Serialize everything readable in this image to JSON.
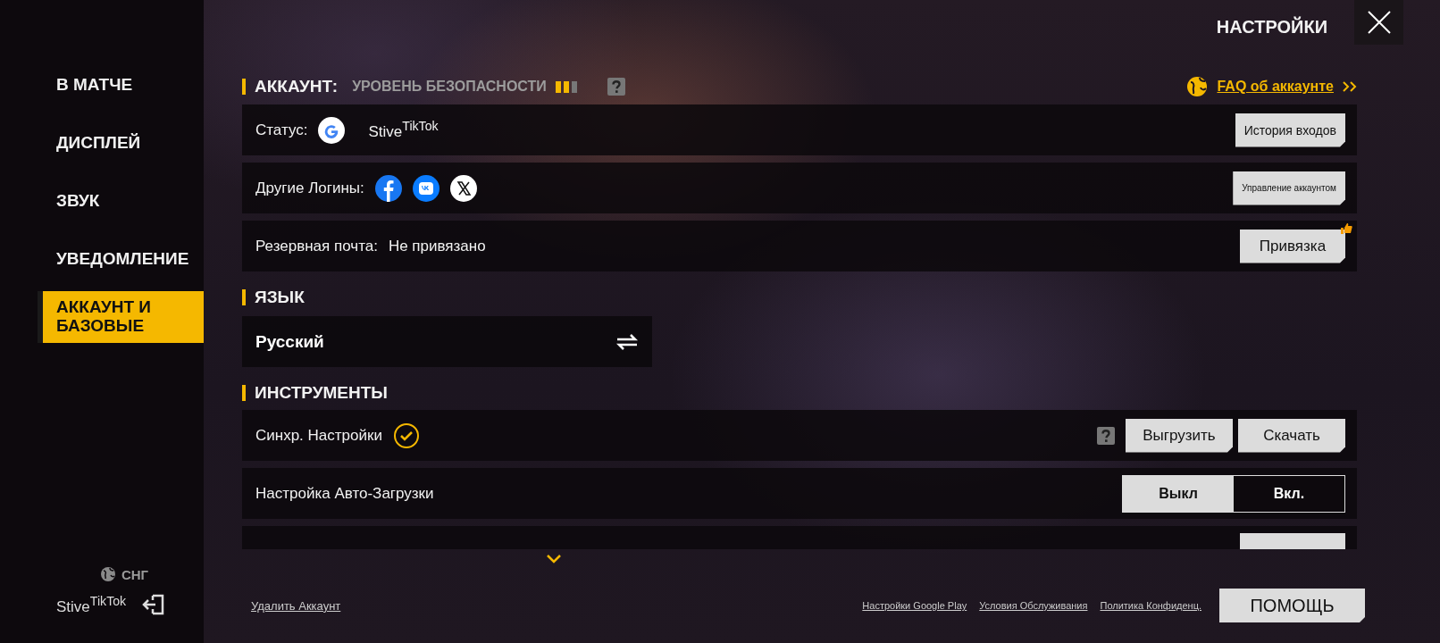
{
  "header": {
    "title": "НАСТРОЙКИ"
  },
  "sidebar": {
    "items": [
      {
        "label": "В МАТЧЕ",
        "selected": false
      },
      {
        "label": "ДИСПЛЕЙ",
        "selected": false
      },
      {
        "label": "ЗВУК",
        "selected": false
      },
      {
        "label": "УВЕДОМЛЕНИЕ",
        "selected": false
      },
      {
        "label": "АККАУНТ И БАЗОВЫЕ",
        "selected": true
      }
    ],
    "region": "СНГ",
    "username": "Stive$^{TikTok}$"
  },
  "account": {
    "title": "АККАУНТ:",
    "subtitle": "УРОВЕНЬ БЕЗОПАСНОСТИ",
    "level": 0.67,
    "link": "FAQ об аккаунте",
    "rows": [
      {
        "kind": "status",
        "label": "Статус:",
        "value": "Stive$^{TikTok}$",
        "buttons": [
          "История входов"
        ]
      },
      {
        "kind": "logins",
        "label": "Другие Логины:",
        "buttons": [
          "Управление аккаунтом"
        ]
      },
      {
        "kind": "text",
        "label": "Резервная почта:",
        "value": "Не привязано",
        "buttons": [
          "Привязка"
        ]
      }
    ]
  },
  "language": {
    "title": "ЯЗЫК",
    "value": "Русский"
  },
  "tools": {
    "title": "ИНСТРУМЕНТЫ",
    "rows": [
      {
        "kind": "sync",
        "label": "Синхр. Настройки",
        "checked": true,
        "buttons": [
          "Выгрузить",
          "Скачать"
        ]
      },
      {
        "kind": "toggle",
        "label": "Настройка Авто-Загрузки",
        "options": [
          {
            "label": "Выкл",
            "selected": false
          },
          {
            "label": "Вкл.",
            "selected": true
          }
        ]
      },
      {
        "kind": "clipped"
      }
    ]
  },
  "footer": {
    "delete": "Удалить Аккаунт",
    "links": [
      "Настройки Google Play",
      "Условия Обслуживания",
      "Политика Конфиденц."
    ],
    "help": "ПОМОЩЬ"
  }
}
